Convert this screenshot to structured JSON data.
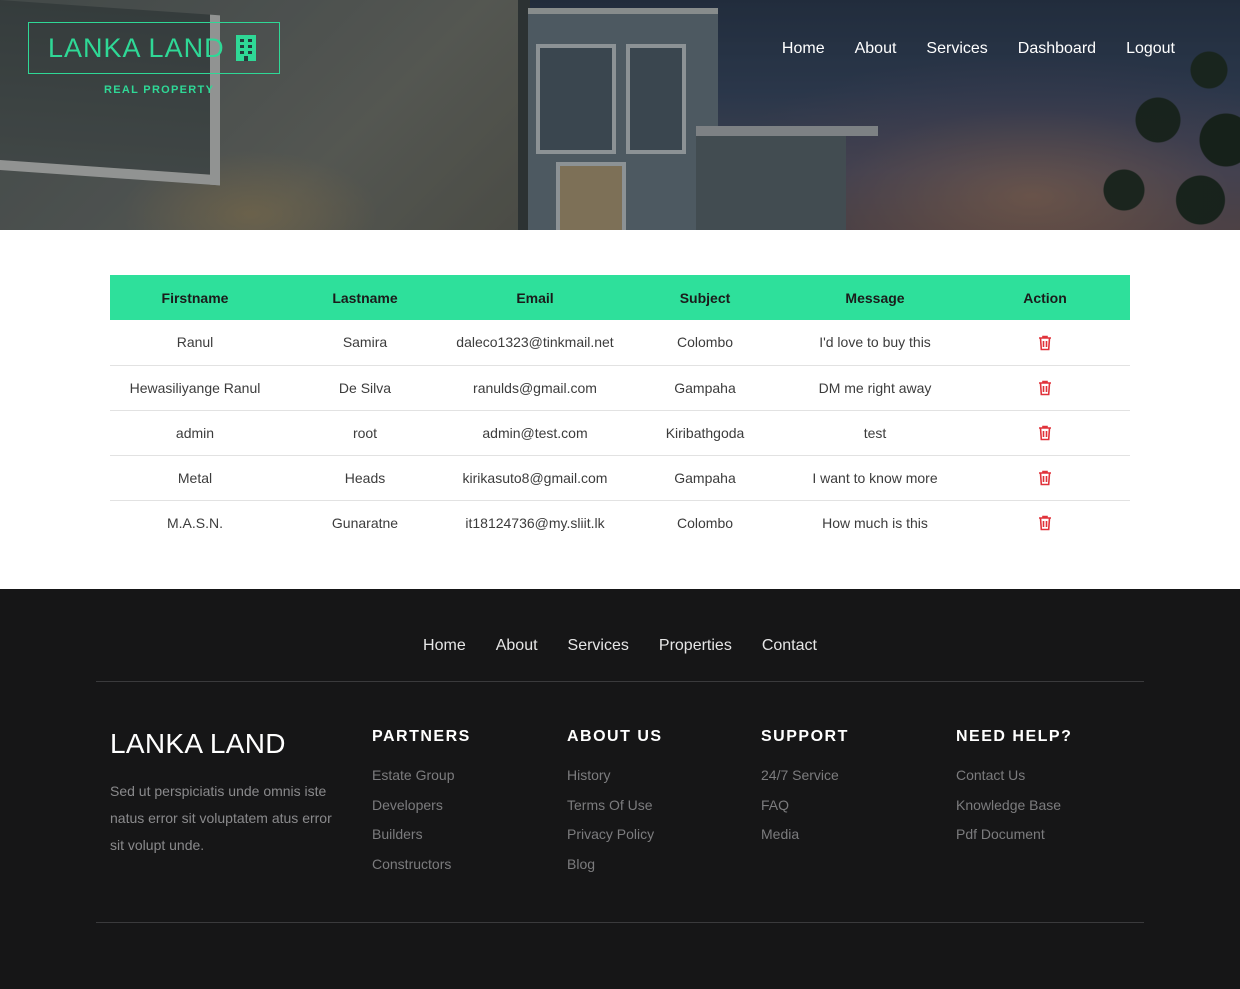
{
  "header": {
    "brand_name": "LANKA LAND",
    "brand_sub": "REAL PROPERTY",
    "brand_icon": "building-icon",
    "nav": [
      {
        "label": "Home"
      },
      {
        "label": "About"
      },
      {
        "label": "Services"
      },
      {
        "label": "Dashboard"
      },
      {
        "label": "Logout"
      }
    ]
  },
  "table": {
    "columns": [
      "Firstname",
      "Lastname",
      "Email",
      "Subject",
      "Message",
      "Action"
    ],
    "rows": [
      {
        "firstname": "Ranul",
        "lastname": "Samira",
        "email": "daleco1323@tinkmail.net",
        "subject": "Colombo",
        "message": "I'd love to buy this"
      },
      {
        "firstname": "Hewasiliyange Ranul",
        "lastname": "De Silva",
        "email": "ranulds@gmail.com",
        "subject": "Gampaha",
        "message": "DM me right away"
      },
      {
        "firstname": "admin",
        "lastname": "root",
        "email": "admin@test.com",
        "subject": "Kiribathgoda",
        "message": "test"
      },
      {
        "firstname": "Metal",
        "lastname": "Heads",
        "email": "kirikasuto8@gmail.com",
        "subject": "Gampaha",
        "message": "I want to know more"
      },
      {
        "firstname": "M.A.S.N.",
        "lastname": "Gunaratne",
        "email": "it18124736@my.sliit.lk",
        "subject": "Colombo",
        "message": "How much is this"
      }
    ],
    "action_icon": "trash-icon"
  },
  "footer": {
    "nav": [
      {
        "label": "Home"
      },
      {
        "label": "About"
      },
      {
        "label": "Services"
      },
      {
        "label": "Properties"
      },
      {
        "label": "Contact"
      }
    ],
    "brand": "LANKA LAND",
    "description": "Sed ut perspiciatis unde omnis iste natus error sit voluptatem atus error sit volupt unde.",
    "columns": [
      {
        "title": "PARTNERS",
        "links": [
          "Estate Group",
          "Developers",
          "Builders",
          "Constructors"
        ]
      },
      {
        "title": "ABOUT US",
        "links": [
          "History",
          "Terms Of Use",
          "Privacy Policy",
          "Blog"
        ]
      },
      {
        "title": "SUPPORT",
        "links": [
          "24/7 Service",
          "FAQ",
          "Media"
        ]
      },
      {
        "title": "NEED HELP?",
        "links": [
          "Contact Us",
          "Knowledge Base",
          "Pdf Document"
        ]
      }
    ]
  },
  "colors": {
    "accent": "#2fd896",
    "table_header": "#2ee09b",
    "delete": "#e0323a",
    "footer_bg": "#161617"
  }
}
